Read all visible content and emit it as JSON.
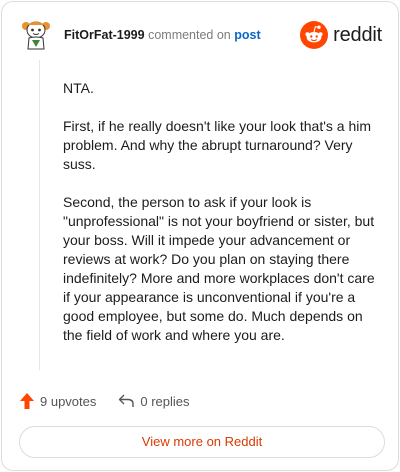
{
  "comment": {
    "username": "FitOrFat-1999",
    "action_text": "commented on",
    "post_link_label": "post",
    "avatar_icon": "snoo-avatar-icon",
    "paragraphs": [
      "NTA.",
      "First, if he really doesn't like your look that's a him problem. And why the abrupt turnaround? Very suss.",
      "Second, the person to ask if your look is \"unprofessional\" is not your boyfriend or sister, but your boss. Will it impede your advancement or reviews at work? Do you plan on staying there indefinitely? More and more workplaces don't care if your appearance is unconventional if you're a good employee, but some do. Much depends on the field of work and where you are."
    ]
  },
  "brand": {
    "wordmark": "reddit",
    "icon": "reddit-logo-icon",
    "color": "#ff4500"
  },
  "stats": {
    "upvotes_label": "9 upvotes",
    "replies_label": "0 replies",
    "upvote_icon": "upvote-arrow-icon",
    "reply_icon": "reply-arrow-icon",
    "upvote_color": "#ff4500"
  },
  "cta": {
    "label": "View more on Reddit",
    "color": "#d93a00"
  }
}
